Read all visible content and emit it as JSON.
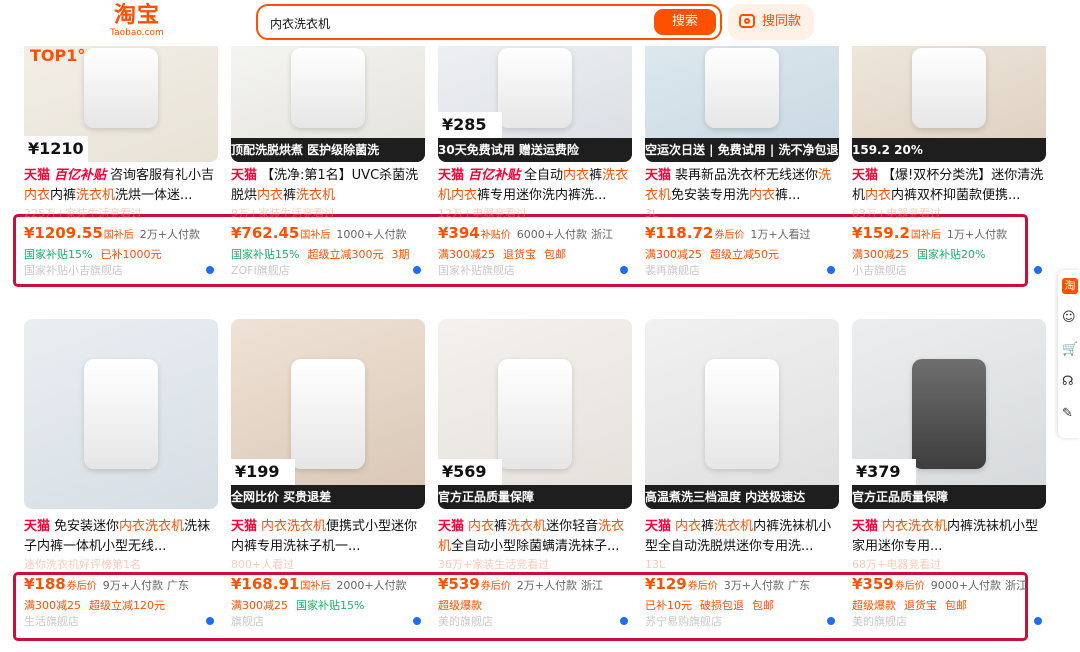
{
  "header": {
    "logo_cn": "淘宝",
    "logo_en": "Taobao.com",
    "search_value": "内衣洗衣机",
    "search_button": "搜索",
    "same_button": "搜同款"
  },
  "colors": {
    "brand": "#ff5000",
    "tmall": "#ff0036",
    "highlight_box": "#c8103a",
    "green_tag": "#1db06a"
  },
  "products": [
    {
      "badge": "TOP1°",
      "band": "",
      "ptag": "1210",
      "title_pre": "天猫",
      "title_sub": "百亿补贴",
      "title": "咨询客服有礼小吉内衣内裤洗衣机洗烘一体迷...",
      "ghost": "225万+家装生活竞看过",
      "price": "¥1209.55",
      "price_label": "国补后",
      "sold": "2万+人付款",
      "location": "",
      "tags": [
        {
          "text": "国家补贴15%",
          "color": "green"
        },
        {
          "text": "已补1000元",
          "color": "orange"
        }
      ],
      "shop": "国家补贴小吉旗舰店"
    },
    {
      "badge": "",
      "band": "顶配洗脱烘煮 医护级除菌洗",
      "ptag": "",
      "title_pre": "天猫",
      "title_sub": "",
      "title": "【洗净:第1名】UVC杀菌洗脱烘内衣裤洗衣机",
      "ghost": "9万+家装生活竞看过",
      "price": "¥762.45",
      "price_label": "国补后",
      "sold": "1000+人付款",
      "location": "",
      "tags": [
        {
          "text": "国家补贴15%",
          "color": "green"
        },
        {
          "text": "超级立减300元",
          "color": "orange"
        },
        {
          "text": "3期",
          "color": "orange"
        }
      ],
      "shop": "ZOFI旗舰店"
    },
    {
      "badge": "",
      "band": "30天免费试用 赠送运费险",
      "ptag": "285",
      "title_pre": "天猫",
      "title_sub": "百亿补贴",
      "title": "全自动内衣裤洗衣机内衣裤专用迷你洗内裤洗...",
      "ghost": "12万+电器竞看过",
      "price": "¥394",
      "price_label": "补贴价",
      "sold": "6000+人付款",
      "location": "浙江",
      "tags": [
        {
          "text": "满300减25",
          "color": "orange"
        },
        {
          "text": "退货宝",
          "color": "orange"
        },
        {
          "text": "包邮",
          "color": "orange"
        }
      ],
      "shop": "国家补贴旗舰店"
    },
    {
      "badge": "",
      "band": "空运次日送 | 免费试用 | 洗不净包退",
      "ptag": "",
      "title_pre": "天猫",
      "title_sub": "",
      "title": "裴再新品洗衣杯无线迷你洗衣机免安装专用洗内衣裤...",
      "ghost": "3L",
      "price": "¥118.72",
      "price_label": "券后价",
      "sold": "1万+人看过",
      "location": "",
      "tags": [
        {
          "text": "满300减25",
          "color": "orange"
        },
        {
          "text": "超级立减50元",
          "color": "orange"
        }
      ],
      "shop": "裴再旗舰店"
    },
    {
      "badge": "",
      "band": "159.2 20%",
      "ptag": "",
      "title_pre": "天猫",
      "title_sub": "",
      "title": "【爆!双杯分类洗】迷你清洗机内衣内裤双杯抑菌款便携...",
      "ghost": "63万+电器竞看过",
      "price": "¥159.2",
      "price_label": "国补后",
      "sold": "1万+人付款",
      "location": "",
      "tags": [
        {
          "text": "满300减25",
          "color": "orange"
        },
        {
          "text": "国家补贴20%",
          "color": "green"
        }
      ],
      "shop": "小吉旗舰店"
    },
    {
      "badge": "",
      "band": "",
      "ptag": "",
      "title_pre": "天猫",
      "title_sub": "",
      "title": "免安装迷你内衣洗衣机洗袜子内裤一体机小型无线...",
      "ghost": "迷你洗衣机好评榜第1名",
      "price": "¥188",
      "price_label": "券后价",
      "sold": "9万+人付款",
      "location": "广东",
      "tags": [
        {
          "text": "满300减25",
          "color": "orange"
        },
        {
          "text": "超级立减120元",
          "color": "orange"
        }
      ],
      "shop": "生活旗舰店"
    },
    {
      "badge": "",
      "band": "全网比价 买贵退差",
      "ptag": "199",
      "title_pre": "天猫",
      "title_sub": "",
      "title": "内衣洗衣机便携式小型迷你内裤专用洗袜子机一...",
      "ghost": "800+人看过",
      "price": "¥168.91",
      "price_label": "国补后",
      "sold": "2000+人付款",
      "location": "",
      "tags": [
        {
          "text": "满300减25",
          "color": "orange"
        },
        {
          "text": "国家补贴15%",
          "color": "green"
        }
      ],
      "shop": "旗舰店"
    },
    {
      "badge": "",
      "band": "官方正品质量保障",
      "ptag": "569",
      "title_pre": "天猫",
      "title_sub": "",
      "title": "内衣裤洗衣机迷你轻音洗衣机全自动小型除菌螨清洗袜子...",
      "ghost": "36万+家装生活竞看过",
      "price": "¥539",
      "price_label": "券后价",
      "sold": "2万+人付款",
      "location": "浙江",
      "tags": [
        {
          "text": "超级爆款",
          "color": "orange"
        }
      ],
      "shop": "美的旗舰店"
    },
    {
      "badge": "",
      "band": "高温煮洗三档温度 内送极速达",
      "ptag": "",
      "title_pre": "天猫",
      "title_sub": "",
      "title": "内衣裤洗衣机内裤洗袜机小型全自动洗脱烘迷你专用洗...",
      "ghost": "13L",
      "price": "¥129",
      "price_label": "券后价",
      "sold": "3万+人付款",
      "location": "广东",
      "tags": [
        {
          "text": "已补10元",
          "color": "orange"
        },
        {
          "text": "破损包退",
          "color": "orange"
        },
        {
          "text": "包邮",
          "color": "orange"
        }
      ],
      "shop": "苏宁易购旗舰店"
    },
    {
      "badge": "",
      "band": "官方正品质量保障",
      "ptag": "379",
      "title_pre": "天猫",
      "title_sub": "",
      "title": "内衣洗衣机内裤洗袜机小型家用迷你专用...",
      "ghost": "68万+电器竞看过",
      "price": "¥359",
      "price_label": "券后价",
      "sold": "9000+人付款",
      "location": "浙江",
      "tags": [
        {
          "text": "超级爆款",
          "color": "orange"
        },
        {
          "text": "退货宝",
          "color": "orange"
        },
        {
          "text": "包邮",
          "color": "orange"
        }
      ],
      "shop": "美的旗舰店"
    }
  ],
  "rail": {
    "tao": "淘",
    "items": [
      "cart-icon",
      "service-icon",
      "feedback-icon"
    ]
  }
}
